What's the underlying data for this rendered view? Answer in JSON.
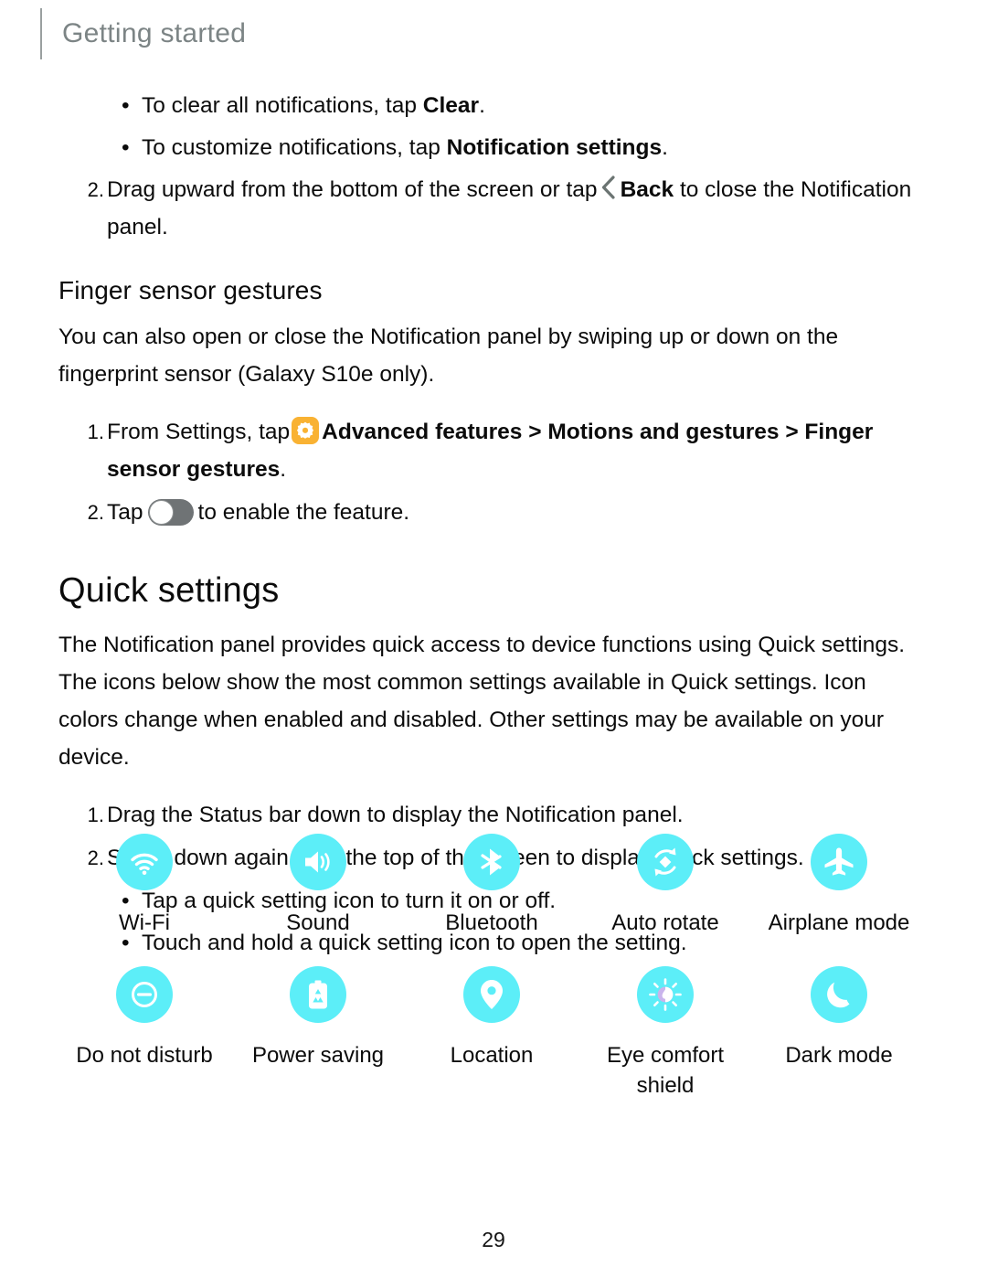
{
  "header": {
    "title": "Getting started"
  },
  "colors": {
    "icon_background": "#5ceef8",
    "gear_badge": "#f9b233",
    "header_text": "#7c8485",
    "back_chevron": "#6b7472",
    "toggle_track": "#6f7375"
  },
  "body": {
    "bullet_1_prefix": "To clear all notifications, tap ",
    "bullet_1_bold": "Clear",
    "bullet_1_suffix": ".",
    "bullet_2_prefix": "To customize notifications, tap ",
    "bullet_2_bold": "Notification settings",
    "bullet_2_suffix": ".",
    "step_2_number": "2.",
    "step_2_text_a": "Drag upward from the bottom of the screen or tap",
    "step_2_bold": "Back",
    "step_2_text_b": " to close the Notification panel."
  },
  "finger_sensor": {
    "heading": "Finger sensor gestures",
    "paragraph": "You can also open or close the Notification panel by swiping up or down on the fingerprint sensor (Galaxy S10e only).",
    "step_1_number": "1.",
    "step_1_text_a": "From Settings, tap",
    "step_1_bold": "Advanced features > Motions and gestures > Finger sensor gestures",
    "step_1_text_b": ".",
    "step_2_number": "2.",
    "step_2_text_a": "Tap",
    "step_2_text_b": "to enable the feature."
  },
  "quick_settings": {
    "heading": "Quick settings",
    "paragraph": "The Notification panel provides quick access to device functions using Quick settings. The icons below show the most common settings available in Quick settings. Icon colors change when enabled and disabled. Other settings may be available on your device.",
    "step_1_number": "1.",
    "step_1_text": "Drag the Status bar down to display the Notification panel.",
    "step_2_number": "2.",
    "step_2_text": "Swipe down again from the top of the screen to display Quick settings.",
    "bullet_1": "Tap a quick setting icon to turn it on or off.",
    "bullet_2": "Touch and hold a quick setting icon to open the setting.",
    "icons_row_1": [
      {
        "label": "Wi-Fi",
        "icon": "wifi-icon"
      },
      {
        "label": "Sound",
        "icon": "sound-icon"
      },
      {
        "label": "Bluetooth",
        "icon": "bluetooth-icon"
      },
      {
        "label": "Auto rotate",
        "icon": "auto-rotate-icon"
      },
      {
        "label": "Airplane mode",
        "icon": "airplane-mode-icon"
      }
    ],
    "icons_row_2": [
      {
        "label": "Do not disturb",
        "icon": "do-not-disturb-icon"
      },
      {
        "label": "Power saving",
        "icon": "power-saving-icon"
      },
      {
        "label": "Location",
        "icon": "location-icon"
      },
      {
        "label": "Eye comfort shield",
        "icon": "eye-comfort-shield-icon"
      },
      {
        "label": "Dark mode",
        "icon": "dark-mode-icon"
      }
    ]
  },
  "footer": {
    "page_number": "29"
  }
}
